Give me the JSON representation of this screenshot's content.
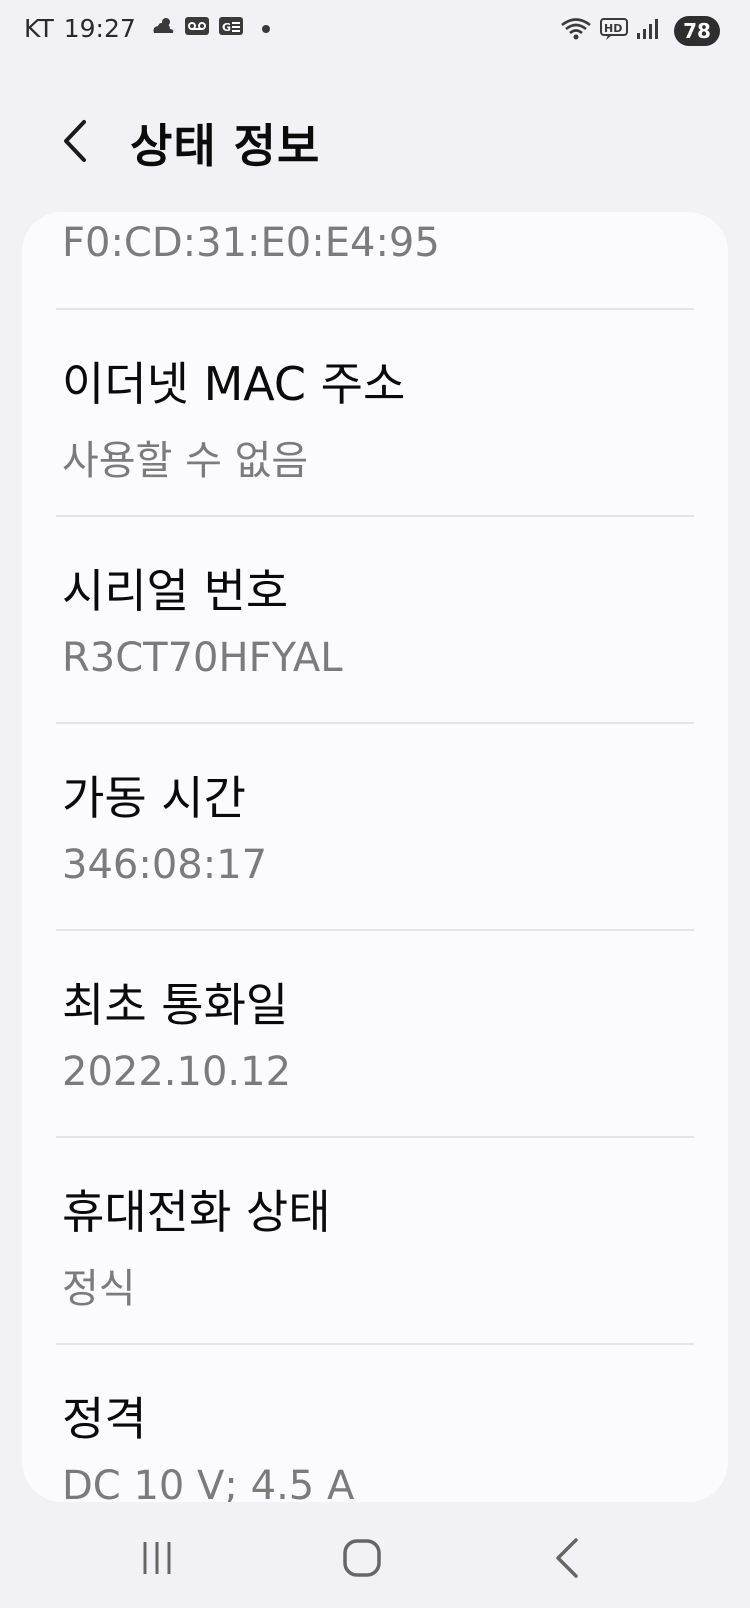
{
  "status_bar": {
    "carrier": "KT",
    "time": "19:27",
    "battery": "78"
  },
  "header": {
    "title": "상태 정보"
  },
  "top_value": "F0:CD:31:E0:E4:95",
  "items": [
    {
      "title": "이더넷 MAC 주소",
      "value": "사용할 수 없음"
    },
    {
      "title": "시리얼 번호",
      "value": "R3CT70HFYAL"
    },
    {
      "title": "가동 시간",
      "value": "346:08:17"
    },
    {
      "title": "최초 통화일",
      "value": "2022.10.12"
    },
    {
      "title": "휴대전화 상태",
      "value": "정식"
    },
    {
      "title": "정격",
      "value": "DC 10 V; 4.5 A"
    }
  ],
  "colors": {
    "background": "#f2f2f6",
    "card": "#fbfbfd",
    "secondary_text": "#7b7b7b",
    "divider": "#e4e4e8"
  }
}
